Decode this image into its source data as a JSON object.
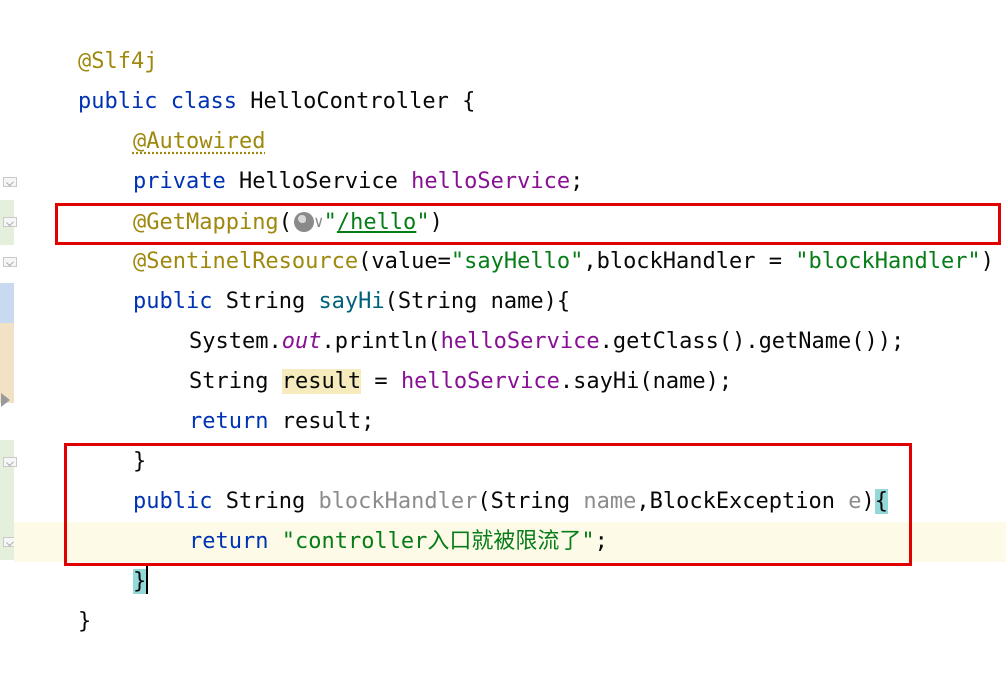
{
  "editor": {
    "language": "Java",
    "lines": {
      "l1": {
        "annotation": "@Slf4j"
      },
      "l2": {
        "kw1": "public",
        "kw2": "class",
        "name": "HelloController",
        "rest": " {"
      },
      "l3": {
        "annotation": "@Autowired"
      },
      "l4": {
        "kw": "private",
        "type": " HelloService ",
        "field": "helloService",
        "rest": ";"
      },
      "l5": {
        "annotation": "@GetMapping",
        "open": "(",
        "quote_open": "\"",
        "path": "/hello",
        "quote_close": "\"",
        "close": ")"
      },
      "l6": {
        "annotation": "@SentinelResource",
        "p1": "(value=",
        "v1": "\"sayHello\"",
        "p2": ",blockHandler = ",
        "v2": "\"blockHandler\"",
        "p3": ")"
      },
      "l7": {
        "kw": "public",
        "type": " String ",
        "method": "sayHi",
        "rest": "(String name){"
      },
      "l8": {
        "a": "System.",
        "b": "out",
        "c": ".println(",
        "d": "helloService",
        "e": ".getClass().getName());"
      },
      "l9": {
        "a": "String ",
        "b": "result",
        "c": " = ",
        "d": "helloService",
        "e": ".sayHi(name);"
      },
      "l10": {
        "kw": "return",
        "rest": " result;"
      },
      "l11": {
        "text": "}"
      },
      "l12": {
        "kw": "public",
        "type": " String ",
        "method": "blockHandler",
        "p1": "(String ",
        "a1": "name",
        "p2": ",BlockException ",
        "a2": "e",
        "p3": ")",
        "brace": "{"
      },
      "l13": {
        "kw": "return",
        "sp": " ",
        "str": "\"controller入口就被限流了\"",
        "rest": ";"
      },
      "l14": {
        "brace": "}"
      },
      "l15": {
        "text": "}"
      }
    }
  },
  "colors": {
    "keyword": "#0033b3",
    "annotation": "#9e880d",
    "field": "#871094",
    "string": "#067d17",
    "highlight_box": "#e00000"
  }
}
